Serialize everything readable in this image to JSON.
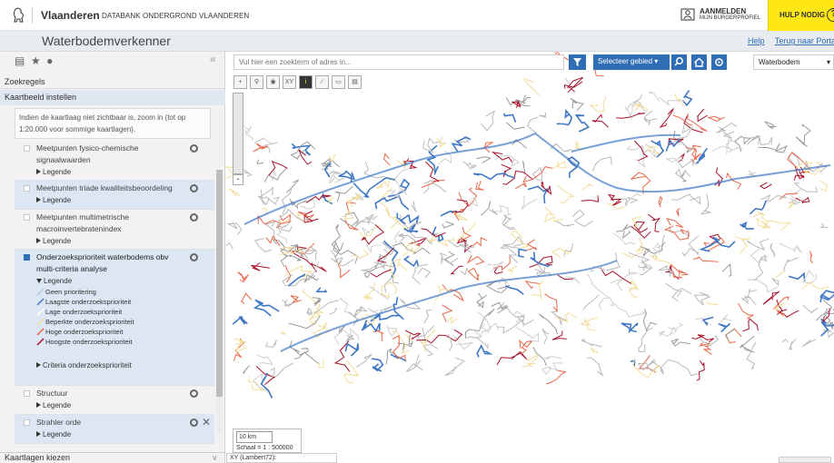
{
  "header": {
    "brand": "Vlaanderen",
    "subtitle": "DATABANK ONDERGROND VLAANDEREN",
    "login_line1": "AANMELDEN",
    "login_line2": "MIJN BURGERPROFIEL",
    "help_label": "HULP NODIG",
    "help_icon": "?"
  },
  "titlebar": {
    "title": "Waterbodemverkenner",
    "help_link": "Help",
    "portal_link": "Terug naar Porta"
  },
  "sidebar": {
    "zoekregels": "Zoekregels",
    "kaartbeeld": "Kaartbeeld instellen",
    "hint": "Indien de kaartlaag niet zichtbaar is, zoom in (tot op 1:20.000 voor sommige kaartlagen).",
    "legend_label": "Legende",
    "layers": [
      {
        "name": "Meetpunten fysico-chemische signaalwaarden",
        "checked": false
      },
      {
        "name": "Meetpunten triade kwaliteitsbeoordeling",
        "checked": false
      },
      {
        "name": "Meetpunten multimetrische macroinvertebratenindex",
        "checked": false
      },
      {
        "name": "Onderzoeksprioriteit waterbodems obv multi-criteria analyse",
        "checked": true
      },
      {
        "name": "Structuur",
        "checked": false
      },
      {
        "name": "Strahler orde",
        "checked": false
      }
    ],
    "legend_items": [
      {
        "label": "Geen prioritering",
        "color": "#b4c8e6"
      },
      {
        "label": "Laagste onderzoeksprioriteit",
        "color": "#3f78c4"
      },
      {
        "label": "Lage onderzoeksprioriteit",
        "color": "#ffffff"
      },
      {
        "label": "Beperkte onderzoeksprioriteit",
        "color": "#f3dc98"
      },
      {
        "label": "Hoge onderzoeksprioriteit",
        "color": "#e8674a"
      },
      {
        "label": "Hoogste onderzoeksprioriteit",
        "color": "#a8102a"
      }
    ],
    "criteria_label": "Criteria onderzoeksprioriteit",
    "kaartlagen": "Kaartlagen kiezen"
  },
  "map": {
    "search_placeholder": "Vul hier een zoekterm of adres in...",
    "select_area": "Selecteer gebied",
    "layer_select": "Waterbodem",
    "xy_tool": "XY",
    "scale_distance": "10 km",
    "scale_ratio": "Schaal = 1 : 500000",
    "coords_label": "XY (Lambert72):"
  },
  "colors": {
    "accent": "#2f6db5",
    "help_yellow": "#ffe615",
    "panel_bg": "#f2f2f2",
    "river_blue": "#3f78c4",
    "river_red": "#a8102a",
    "river_orange": "#e8674a",
    "river_yellow": "#f3dc98"
  }
}
